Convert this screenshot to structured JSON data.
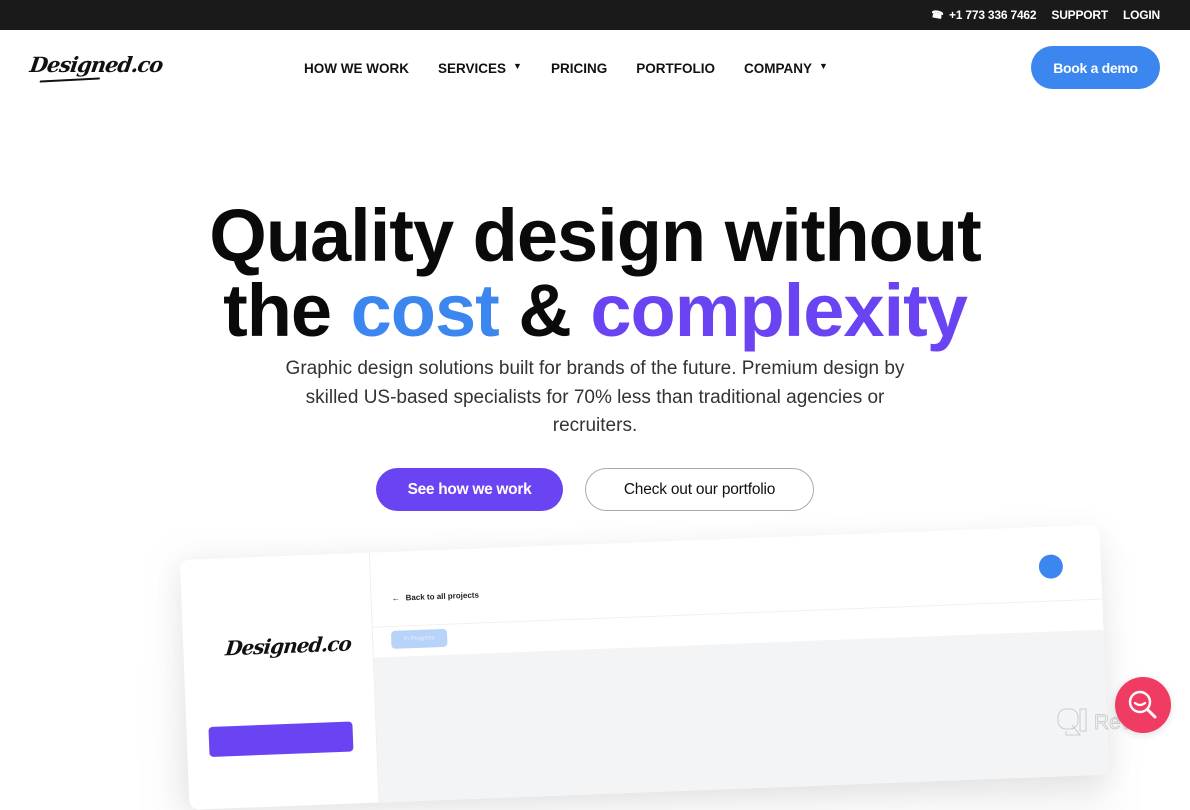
{
  "topbar": {
    "phone_icon": "phone-icon",
    "phone": "+1 773 336 7462",
    "support": "SUPPORT",
    "login": "LOGIN"
  },
  "navbar": {
    "logo": "Designed.co",
    "items": [
      {
        "label": "HOW WE WORK",
        "has_dropdown": false
      },
      {
        "label": "SERVICES",
        "has_dropdown": true
      },
      {
        "label": "PRICING",
        "has_dropdown": false
      },
      {
        "label": "PORTFOLIO",
        "has_dropdown": false
      },
      {
        "label": "COMPANY",
        "has_dropdown": true
      }
    ],
    "caret": "▼",
    "cta": "Book a demo"
  },
  "hero": {
    "title_line1": "Quality design without",
    "title_line2_part1": "the ",
    "title_line2_highlight1": "cost",
    "title_line2_part2": " & ",
    "title_line2_highlight2": "complexity",
    "subtitle": "Graphic design solutions built for brands of the future. Premium design by skilled US-based specialists for 70% less than traditional agencies or recruiters.",
    "primary_button": "See how we work",
    "secondary_button": "Check out our portfolio"
  },
  "mockup": {
    "logo": "Designed.co",
    "back_arrow": "←",
    "back_link": "Back to all projects",
    "status_chip": "In Progress"
  },
  "widgets": {
    "chat_icon": "search-smile-icon",
    "watermark": "Revain"
  },
  "colors": {
    "topbar_bg": "#1a1a1a",
    "accent_blue": "#3b87ef",
    "accent_purple": "#6a44f2",
    "chat_red": "#f03c62"
  }
}
